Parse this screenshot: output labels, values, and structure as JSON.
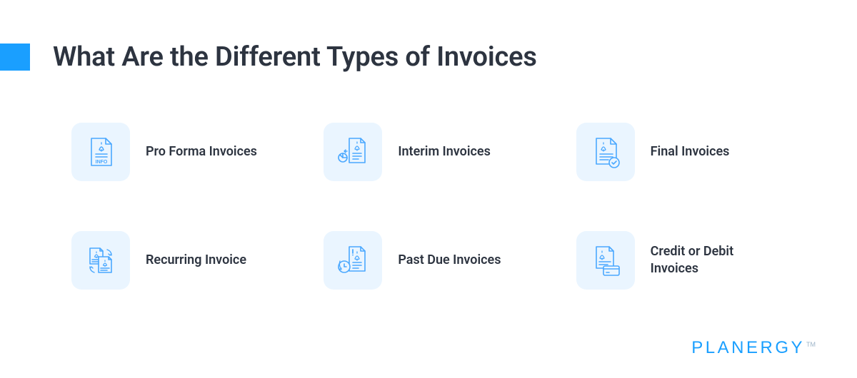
{
  "title": "What Are the Different Types of Invoices",
  "brand": "PLANERGY",
  "colors": {
    "accent": "#1a9fff",
    "iconBg": "#eaf5ff",
    "iconStroke": "#4aa8ff",
    "text": "#2d3440"
  },
  "items": [
    {
      "icon": "invoice-info-icon",
      "label": "Pro Forma Invoices"
    },
    {
      "icon": "invoice-piechart-icon",
      "label": "Interim Invoices"
    },
    {
      "icon": "invoice-check-icon",
      "label": "Final Invoices"
    },
    {
      "icon": "invoice-cycle-icon",
      "label": "Recurring Invoice"
    },
    {
      "icon": "invoice-clock-icon",
      "label": "Past Due Invoices"
    },
    {
      "icon": "invoice-card-icon",
      "label": "Credit or Debit Invoices"
    }
  ]
}
